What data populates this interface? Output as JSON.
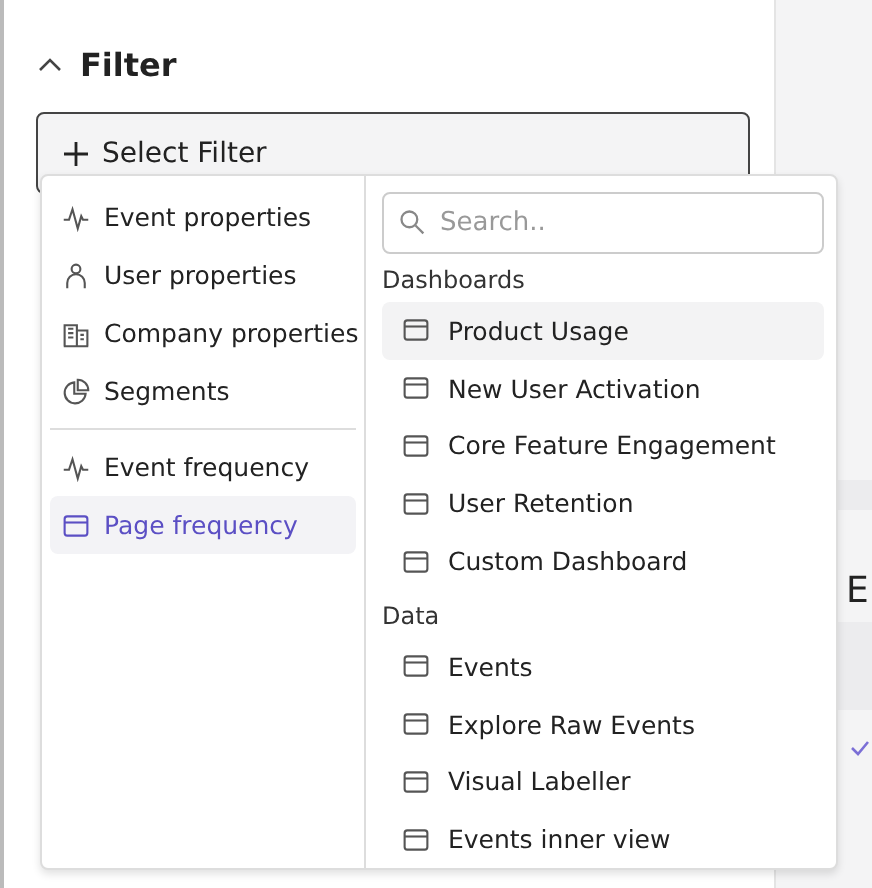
{
  "filter": {
    "title": "Filter",
    "expanded": true,
    "button": "Select Filter"
  },
  "menu": {
    "sections": [
      {
        "items": [
          {
            "label": "Event properties",
            "kind": "event",
            "selected": false
          },
          {
            "label": "User properties",
            "kind": "user",
            "selected": false
          },
          {
            "label": "Company properties",
            "kind": "company",
            "selected": false
          },
          {
            "label": "Segments",
            "kind": "segment",
            "selected": false
          }
        ]
      },
      {
        "items": [
          {
            "label": "Event frequency",
            "kind": "event",
            "selected": false
          },
          {
            "label": "Page frequency",
            "kind": "page",
            "selected": true
          }
        ]
      }
    ]
  },
  "search": {
    "placeholder": "Search.."
  },
  "groups": [
    {
      "heading": "Dashboards",
      "items": [
        {
          "label": "Product Usage",
          "selected": true
        },
        {
          "label": "New User Activation",
          "selected": false
        },
        {
          "label": "Core Feature Engagement",
          "selected": false
        },
        {
          "label": "User Retention",
          "selected": false
        },
        {
          "label": "Custom Dashboard",
          "selected": false
        }
      ]
    },
    {
      "heading": "Data",
      "items": [
        {
          "label": "Events",
          "selected": false
        },
        {
          "label": "Explore Raw Events",
          "selected": false
        },
        {
          "label": "Visual Labeller",
          "selected": false
        },
        {
          "label": "Events inner view",
          "selected": false
        }
      ]
    }
  ],
  "background": {
    "letter": "E",
    "checked": true
  }
}
